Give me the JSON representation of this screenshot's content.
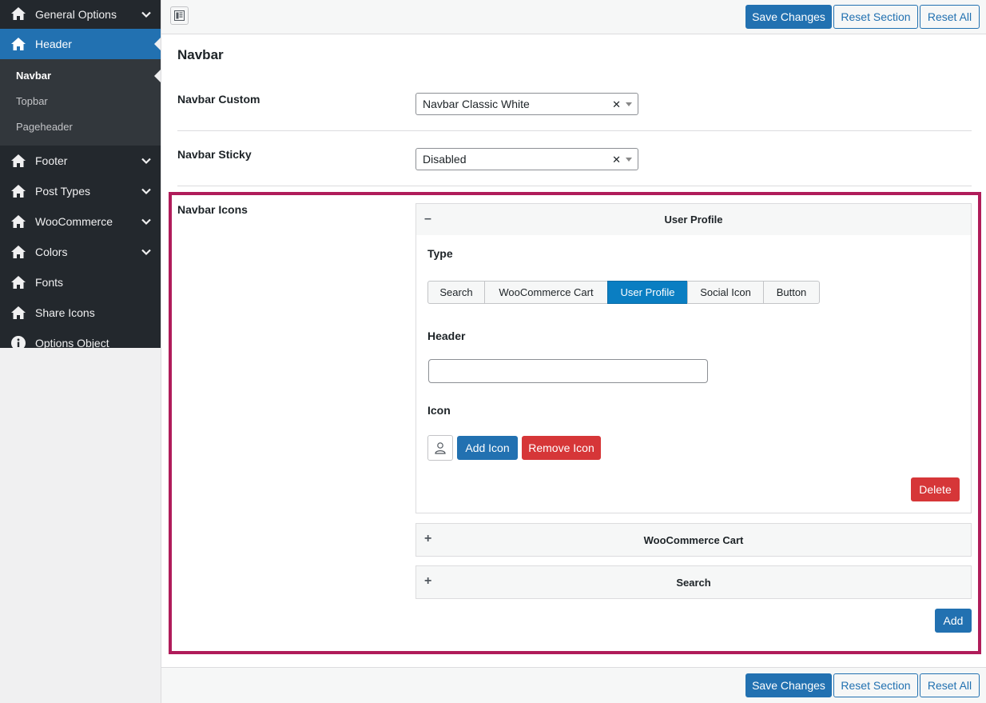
{
  "sidebar": {
    "items": [
      {
        "label": "General Options"
      },
      {
        "label": "Header"
      },
      {
        "label": "Footer"
      },
      {
        "label": "Post Types"
      },
      {
        "label": "WooCommerce"
      },
      {
        "label": "Colors"
      },
      {
        "label": "Fonts"
      },
      {
        "label": "Share Icons"
      },
      {
        "label": "Options Object"
      }
    ],
    "submenu": [
      "Navbar",
      "Topbar",
      "Pageheader"
    ]
  },
  "toolbar": {
    "save_label": "Save Changes",
    "reset_section_label": "Reset Section",
    "reset_all_label": "Reset All"
  },
  "main": {
    "title": "Navbar",
    "navbar_custom": {
      "label": "Navbar Custom",
      "value": "Navbar Classic White"
    },
    "navbar_sticky": {
      "label": "Navbar Sticky",
      "value": "Disabled"
    },
    "navbar_icons": {
      "label": "Navbar Icons",
      "panels": [
        {
          "title": "User Profile",
          "toggle": "–"
        },
        {
          "title": "WooCommerce Cart",
          "toggle": "+"
        },
        {
          "title": "Search",
          "toggle": "+"
        }
      ],
      "type_label": "Type",
      "type_options": [
        "Search",
        "WooCommerce Cart",
        "User Profile",
        "Social Icon",
        "Button"
      ],
      "type_selected": "User Profile",
      "header_label": "Header",
      "header_value": "",
      "icon_label": "Icon",
      "icon_name": "user-icon",
      "add_icon_label": "Add Icon",
      "remove_icon_label": "Remove Icon",
      "delete_label": "Delete",
      "add_label": "Add"
    }
  },
  "colors": {
    "primary": "#2271b1",
    "danger": "#d63638",
    "highlight": "#b01c5a",
    "sidebar_bg": "#23282d",
    "segment_active": "#0a7ec2"
  }
}
